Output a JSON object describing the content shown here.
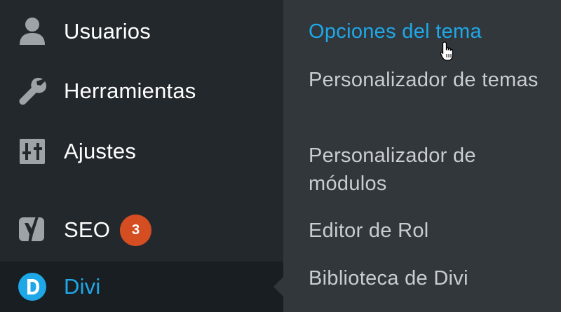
{
  "sidebar": {
    "items": [
      {
        "label": "Usuarios",
        "icon": "user-icon"
      },
      {
        "label": "Herramientas",
        "icon": "wrench-icon"
      },
      {
        "label": "Ajustes",
        "icon": "settings-sliders-icon"
      },
      {
        "label": "SEO",
        "icon": "yoast-icon",
        "badge": "3"
      },
      {
        "label": "Divi",
        "icon": "divi-icon",
        "active": true
      }
    ]
  },
  "submenu": {
    "items": [
      {
        "label": "Opciones del tema",
        "current": true
      },
      {
        "label": "Personalizador de temas"
      },
      {
        "label": "Personalizador de módulos"
      },
      {
        "label": "Editor de Rol"
      },
      {
        "label": "Biblioteca de Divi"
      }
    ]
  },
  "colors": {
    "sidebar_bg": "#23282d",
    "submenu_bg": "#32373c",
    "accent": "#1ea8e8",
    "badge": "#d54e21"
  }
}
